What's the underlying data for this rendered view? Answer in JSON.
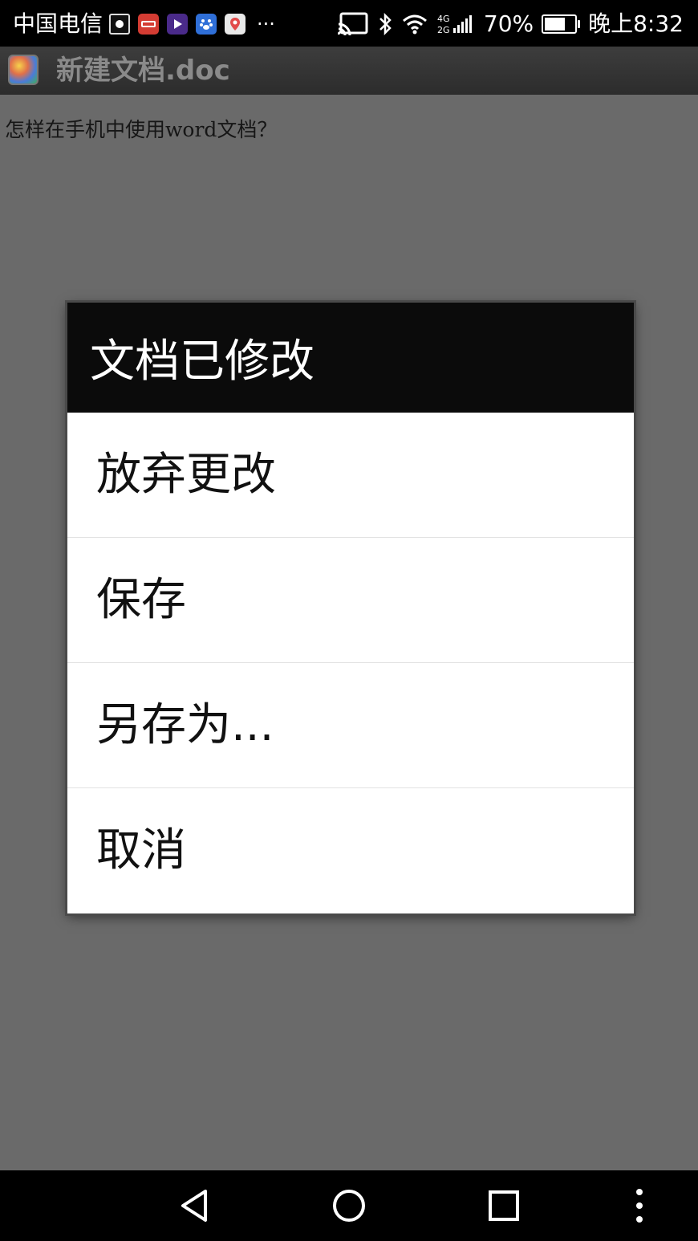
{
  "status_bar": {
    "carrier": "中国电信",
    "notification_icons": [
      "screenshot-icon",
      "toutiao-icon",
      "video-icon",
      "baidu-icon",
      "map-icon"
    ],
    "more_indicator": "···",
    "battery_percent": "70%",
    "battery_level": 0.7,
    "time": "晚上8:32"
  },
  "app_bar": {
    "icon": "app-icon",
    "title": "新建文档.doc"
  },
  "document": {
    "text": "怎样在手机中使用word文档？"
  },
  "dialog": {
    "title": "文档已修改",
    "options": [
      {
        "label": "放弃更改"
      },
      {
        "label": "保存"
      },
      {
        "label": "另存为..."
      },
      {
        "label": "取消"
      }
    ]
  },
  "nav_bar": {
    "buttons": [
      "back-icon",
      "home-icon",
      "recents-icon",
      "menu-icon"
    ]
  },
  "colors": {
    "status_bar_bg": "#000000",
    "app_bar_bg": "#333333",
    "dim_overlay": "#6a6a6a",
    "dialog_header_bg": "#0b0b0b",
    "dialog_body_bg": "#ffffff"
  }
}
